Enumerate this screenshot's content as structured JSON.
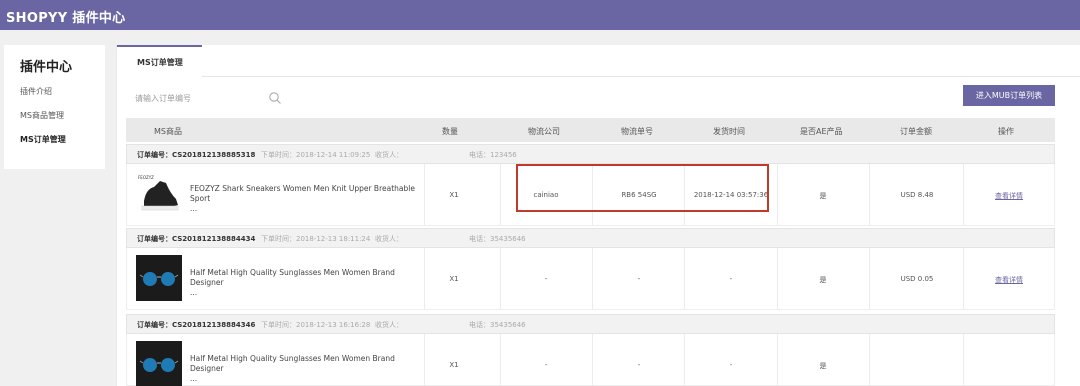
{
  "app": {
    "title": "SHOPYY 插件中心"
  },
  "sidebar": {
    "title": "插件中心",
    "items": [
      {
        "label": "插件介绍"
      },
      {
        "label": "MS商品管理"
      },
      {
        "label": "MS订单管理"
      }
    ]
  },
  "tabs": [
    {
      "label": "MS订单管理"
    }
  ],
  "search": {
    "placeholder": "请输入订单编号"
  },
  "toolbar": {
    "mub_button": "进入MUB订单列表"
  },
  "table": {
    "headers": [
      "MS商品",
      "数量",
      "物流公司",
      "物流单号",
      "发货时间",
      "是否AE产品",
      "订单金额",
      "操作"
    ]
  },
  "orders": [
    {
      "order_no": "订单编号：CS201812138885318",
      "time": "下单时间：2018-12-14 11:09:25",
      "receiver": "收货人：",
      "phone": "电话：123456",
      "product": "FEOZYZ Shark Sneakers Women Men Knit Upper Breathable Sport",
      "ellipsis": "...",
      "qty": "X1",
      "carrier": "cainiao",
      "tracking": "RB6            54SG",
      "ship_time": "2018-12-14 03:57:36",
      "ae": "是",
      "amount": "USD 8.48",
      "action": "查看详情"
    },
    {
      "order_no": "订单编号：CS201812138884434",
      "time": "下单时间：2018-12-13 18:11:24",
      "receiver": "收货人：",
      "phone": "电话：35435646",
      "product": "Half Metal High Quality Sunglasses Men Women Brand Designer",
      "ellipsis": "...",
      "qty": "X1",
      "carrier": "-",
      "tracking": "-",
      "ship_time": "-",
      "ae": "是",
      "amount": "USD 0.05",
      "action": "查看详情"
    },
    {
      "order_no": "订单编号：CS201812138884346",
      "time": "下单时间：2018-12-13 16:16:28",
      "receiver": "收货人：",
      "phone": "电话：35435646",
      "product": "Half Metal High Quality Sunglasses Men Women Brand Designer",
      "ellipsis": "...",
      "qty": "X1",
      "carrier": "-",
      "tracking": "-",
      "ship_time": "-",
      "ae": "是",
      "amount": "",
      "action": ""
    }
  ],
  "colors": {
    "brand": "#6a66a3",
    "highlight": "#c0392b"
  },
  "icons": {
    "search": "search-icon"
  }
}
